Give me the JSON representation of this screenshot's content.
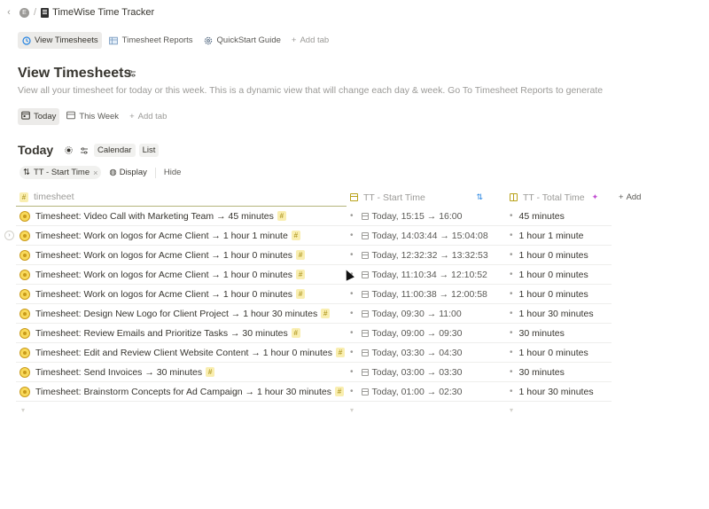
{
  "topbar": {
    "back_icon": "chevron-left-icon",
    "workspace_initial": "E",
    "page_title": "TimeWise Time Tracker"
  },
  "tabs": [
    {
      "label": "View Timesheets",
      "icon": "clock-icon",
      "active": true
    },
    {
      "label": "Timesheet Reports",
      "icon": "table-icon",
      "active": false
    },
    {
      "label": "QuickStart Guide",
      "icon": "gear-icon",
      "active": false
    }
  ],
  "add_tab_label": "Add tab",
  "page": {
    "title": "View Timesheets",
    "description": "View all your timesheet for today or this week. This is a dynamic view that will change each day & week. Go To Timesheet Reports to generate"
  },
  "views": [
    {
      "label": "Today",
      "icon": "calendar-icon",
      "active": true
    },
    {
      "label": "This Week",
      "icon": "table-icon",
      "active": false
    }
  ],
  "views_add_label": "Add tab",
  "section": {
    "title": "Today",
    "calendar_label": "Calendar",
    "list_label": "List"
  },
  "filters": {
    "sort_chip": "TT - Start Time",
    "display_label": "Display",
    "hide_label": "Hide"
  },
  "table": {
    "headers": {
      "name": "timesheet",
      "start": "TT - Start Time",
      "total": "TT - Total Time",
      "add": "Add"
    },
    "rows": [
      {
        "name": "Timesheet: Video Call with Marketing Team → 45 minutes",
        "start": "Today, 15:15 → 16:00",
        "total": "45 minutes"
      },
      {
        "name": "Timesheet: Work on logos for Acme Client → 1 hour 1 minute",
        "start": "Today, 14:03:44 → 15:04:08",
        "total": "1 hour 1 minute"
      },
      {
        "name": "Timesheet: Work on logos for Acme Client → 1 hour 0 minutes",
        "start": "Today, 12:32:32 → 13:32:53",
        "total": "1 hour 0 minutes"
      },
      {
        "name": "Timesheet: Work on logos for Acme Client → 1 hour 0 minutes",
        "start": "Today, 11:10:34 → 12:10:52",
        "total": "1 hour 0 minutes"
      },
      {
        "name": "Timesheet: Work on logos for Acme Client → 1 hour 0 minutes",
        "start": "Today, 11:00:38 → 12:00:58",
        "total": "1 hour 0 minutes"
      },
      {
        "name": "Timesheet: Design New Logo for Client Project → 1 hour 30 minutes",
        "start": "Today, 09:30 → 11:00",
        "total": "1 hour 30 minutes"
      },
      {
        "name": "Timesheet: Review Emails and Prioritize Tasks → 30 minutes",
        "start": "Today, 09:00 → 09:30",
        "total": "30 minutes"
      },
      {
        "name": "Timesheet: Edit and Review Client Website Content → 1 hour 0 minutes",
        "start": "Today, 03:30 → 04:30",
        "total": "1 hour 0 minutes"
      },
      {
        "name": "Timesheet: Send Invoices → 30 minutes",
        "start": "Today, 03:00 → 03:30",
        "total": "30 minutes"
      },
      {
        "name": "Timesheet: Brainstorm Concepts for Ad Campaign → 1 hour 30 minutes",
        "start": "Today, 01:00 → 02:30",
        "total": "1 hour 30 minutes"
      }
    ]
  },
  "colors": {
    "accent": "#2383e2",
    "tag_bg": "#f9eeb0",
    "sun": "#f8d95a"
  }
}
